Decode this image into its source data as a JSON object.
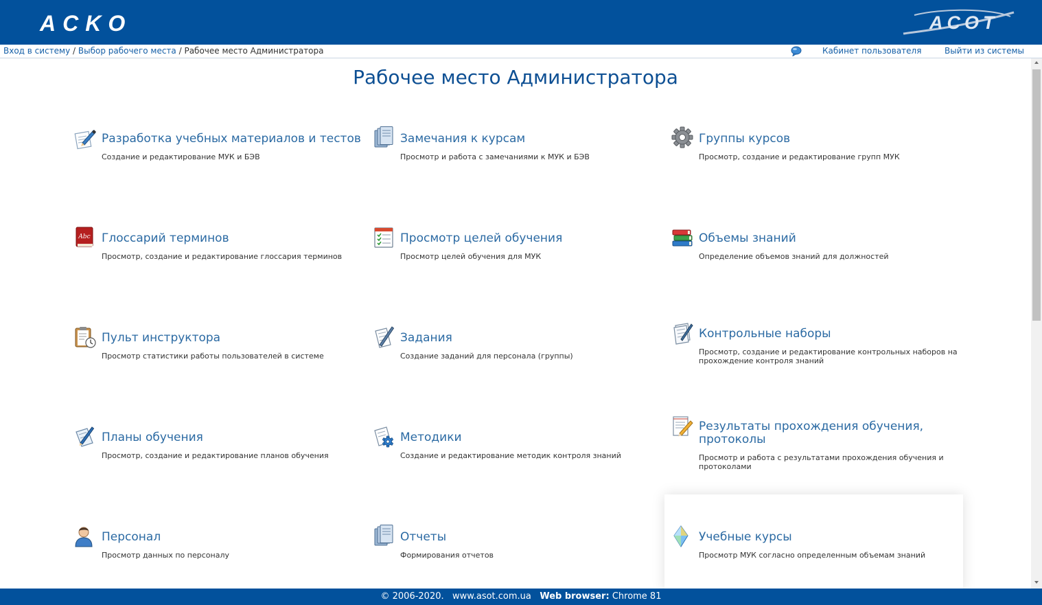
{
  "header": {
    "logo_left": "ACKO",
    "logo_right": "ACOT"
  },
  "nav": {
    "breadcrumb": [
      {
        "label": "Вход в систему",
        "link": true
      },
      {
        "label": "Выбор рабочего места",
        "link": true
      },
      {
        "label": "Рабочее место Администратора",
        "link": false
      }
    ],
    "separator": " / ",
    "cabinet": "Кабинет пользователя",
    "logout": "Выйти из системы"
  },
  "page": {
    "title": "Рабочее место Администратора"
  },
  "tiles": [
    {
      "icon": "pencil-paper-icon",
      "title": "Разработка учебных материалов и тестов",
      "desc": "Создание и редактирование МУК и БЭВ"
    },
    {
      "icon": "books-stack-icon",
      "title": "Замечания к курсам",
      "desc": "Просмотр и работа с замечаниями к МУК и БЭВ"
    },
    {
      "icon": "gear-icon",
      "title": "Группы курсов",
      "desc": "Просмотр, создание и редактирование групп МУК"
    },
    {
      "icon": "abc-book-icon",
      "title": "Глоссарий терминов",
      "desc": "Просмотр, создание и редактирование глоссария терминов"
    },
    {
      "icon": "checklist-calendar-icon",
      "title": "Просмотр целей обучения",
      "desc": "Просмотр целей обучения для МУК"
    },
    {
      "icon": "colored-books-icon",
      "title": "Объемы знаний",
      "desc": "Определение объемов знаний для должностей"
    },
    {
      "icon": "clipboard-clock-icon",
      "title": "Пульт инструктора",
      "desc": "Просмотр статистики работы пользователей в системе"
    },
    {
      "icon": "notepad-pen-icon",
      "title": "Задания",
      "desc": "Создание заданий для персонала (группы)"
    },
    {
      "icon": "document-pen-icon",
      "title": "Контрольные наборы",
      "desc": "Просмотр, создание и редактирование контрольных наборов на прохождение контроля знаний"
    },
    {
      "icon": "plan-pen-icon",
      "title": "Планы обучения",
      "desc": "Просмотр, создание и редактирование планов обучения"
    },
    {
      "icon": "document-gear-icon",
      "title": "Методики",
      "desc": "Создание и редактирование методик контроля знаний"
    },
    {
      "icon": "notepad-pencil-icon",
      "title": "Результаты прохождения обучения, протоколы",
      "desc": "Просмотр и работа с результатами прохождения обучения и протоколами"
    },
    {
      "icon": "person-icon",
      "title": "Персонал",
      "desc": "Просмотр данных по персоналу"
    },
    {
      "icon": "books-stack-icon",
      "title": "Отчеты",
      "desc": "Формирования отчетов"
    },
    {
      "icon": "crystal-icon",
      "title": "Учебные курсы",
      "desc": "Просмотр МУК согласно определенным объемам знаний"
    }
  ],
  "footer": {
    "copyright": "© 2006-2020.",
    "site": "www.asot.com.ua",
    "browser_label": "Web browser:",
    "browser_value": "Chrome 81"
  },
  "colors": {
    "header_bg": "#02519c",
    "title": "#0d4f93",
    "tile_title": "#2b6aa3",
    "link": "#1660a8"
  }
}
